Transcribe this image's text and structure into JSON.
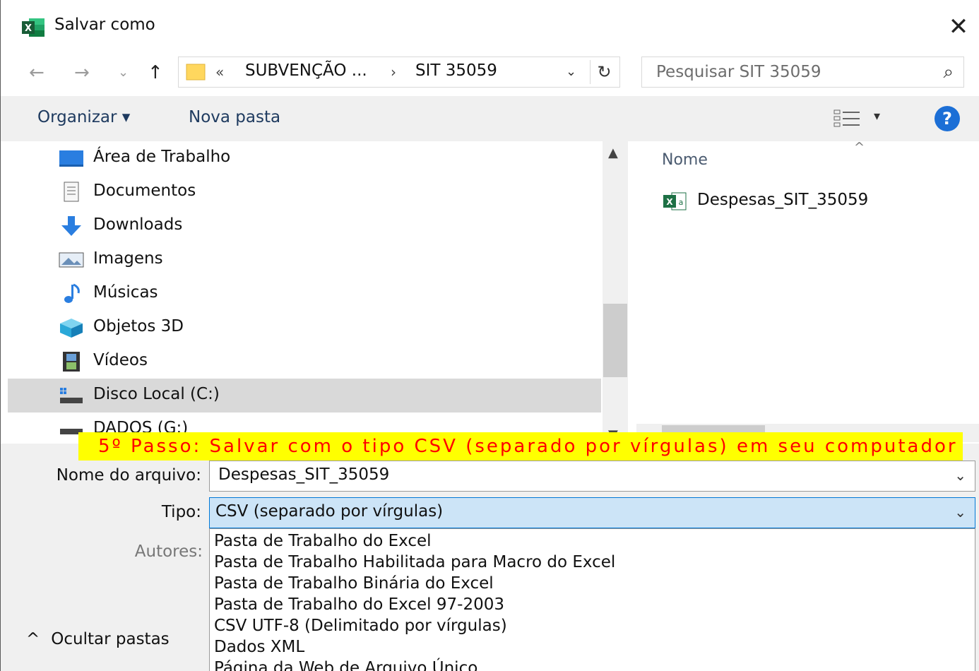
{
  "window": {
    "title": "Salvar como",
    "close_glyph": "✕"
  },
  "nav": {
    "back": "←",
    "forward": "→",
    "recent": "⌄",
    "up": "↑"
  },
  "address": {
    "overflow": "«",
    "crumbs": [
      "SUBVENÇÃO ...",
      "SIT 35059"
    ],
    "separator": "›",
    "dropdown": "⌄",
    "refresh": "↻"
  },
  "search": {
    "placeholder": "Pesquisar SIT 35059",
    "icon": "⌕"
  },
  "toolbar": {
    "organize_label": "Organizar ▾",
    "new_folder_label": "Nova pasta",
    "view_dropdown": "▾",
    "help": "?"
  },
  "navigation_pane": {
    "items": [
      {
        "label": "Área de Trabalho",
        "icon": "desktop-icon"
      },
      {
        "label": "Documentos",
        "icon": "documents-icon"
      },
      {
        "label": "Downloads",
        "icon": "downloads-icon"
      },
      {
        "label": "Imagens",
        "icon": "pictures-icon"
      },
      {
        "label": "Músicas",
        "icon": "music-icon"
      },
      {
        "label": "Objetos 3D",
        "icon": "3d-objects-icon"
      },
      {
        "label": "Vídeos",
        "icon": "videos-icon"
      },
      {
        "label": "Disco Local (C:)",
        "icon": "drive-icon",
        "selected": true
      },
      {
        "label": "DADOS (G:)",
        "icon": "drive-icon"
      }
    ]
  },
  "file_list": {
    "column_header": "Nome",
    "files": [
      {
        "name": "Despesas_SIT_35059",
        "icon": "excel-file-icon"
      }
    ]
  },
  "annotation_banner": "5º Passo: Salvar com o tipo CSV (separado por vírgulas) em seu computador",
  "form": {
    "filename_label": "Nome do arquivo:",
    "filename_value": "Despesas_SIT_35059",
    "type_label": "Tipo:",
    "type_value": "CSV (separado por vírgulas)",
    "authors_label": "Autores:",
    "chevron": "⌄"
  },
  "type_options": [
    "Pasta de Trabalho do Excel",
    "Pasta de Trabalho Habilitada para Macro do Excel",
    "Pasta de Trabalho Binária do Excel",
    "Pasta de Trabalho do Excel 97-2003",
    "CSV UTF-8 (Delimitado por vírgulas)",
    "Dados XML",
    "Página da Web de Arquivo Único"
  ],
  "hide_folders_label": "Ocultar pastas",
  "hide_folders_glyph": "^",
  "colors": {
    "accent": "#0078d7",
    "banner_bg": "#ffff00",
    "banner_text": "#ff0000",
    "excel_green": "#1e7145"
  }
}
